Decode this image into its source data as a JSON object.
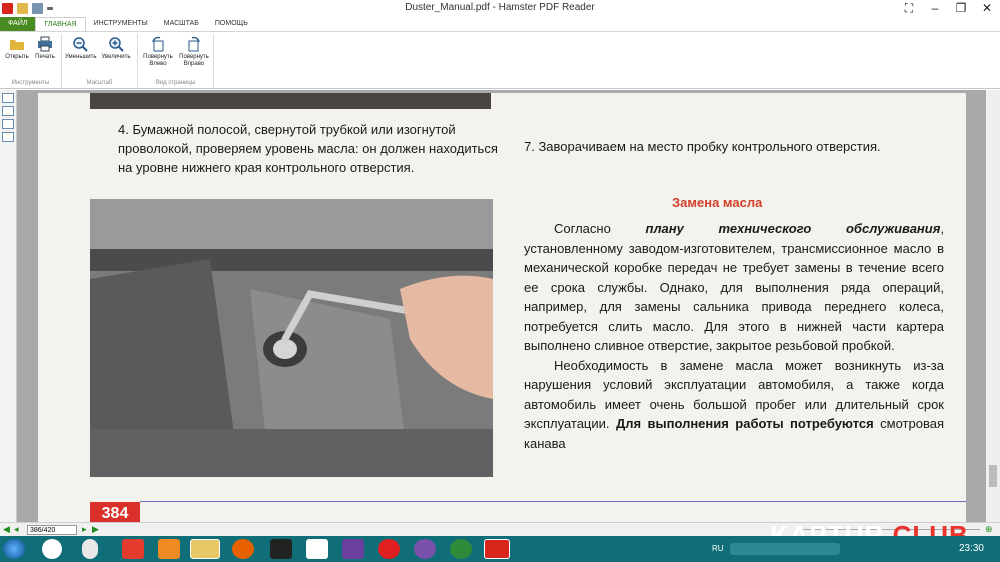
{
  "window": {
    "title": "Duster_Manual.pdf - Hamster PDF Reader"
  },
  "ribbon": {
    "tabs": [
      "ФАЙЛ",
      "ГЛАВНАЯ",
      "ИНСТРУМЕНТЫ",
      "МАСШТАБ",
      "ПОМОЩЬ"
    ],
    "buttons": {
      "open": "Открыть",
      "print": "Печать",
      "zoom_out": "Уменьшить",
      "zoom_in": "Увеличить",
      "rotate_left_1": "Повернуть",
      "rotate_left_2": "Влево",
      "rotate_right_1": "Повернуть",
      "rotate_right_2": "Вправо"
    },
    "groups": {
      "tools": "Инструменты",
      "zoom": "Масштаб",
      "view": "Вид страницы"
    }
  },
  "document": {
    "left_paragraph": "4. Бумажной полосой, свернутой трубкой или изогнутой проволокой, проверяем уровень масла: он должен находиться на уровне нижнего края контрольного отверстия.",
    "right_step7": "7. Заворачиваем на место пробку контрольного отверстия.",
    "section_heading": "Замена масла",
    "para1_start": "Согласно ",
    "para1_emph": "плану технического обслуживания",
    "para1_rest": ", установленному заводом-изготовителем, трансмиссионное масло в механической коробке передач не требует замены в течение всего ее срока службы. Однако, для выполнения ряда операций, например, для замены сальника привода переднего колеса, потребуется слить масло. Для этого в нижней части картера выполнено сливное отверстие, закрытое резьбовой пробкой.",
    "para2_start": "Необходимость в замене масла может возникнуть из-за нарушения условий эксплуатации автомобиля, а также когда автомобиль имеет очень большой пробег или длительный срок эксплуатации. ",
    "para2_bold": "Для выполнения работы потребуются",
    "para2_rest": " смотровая канава",
    "page_number": "384"
  },
  "statusbar": {
    "page_field": "386/420"
  },
  "taskbar": {
    "lang": "RU",
    "time": "23:30"
  },
  "watermark": {
    "part1": "KAPTUR.",
    "part2": "CLUB"
  }
}
